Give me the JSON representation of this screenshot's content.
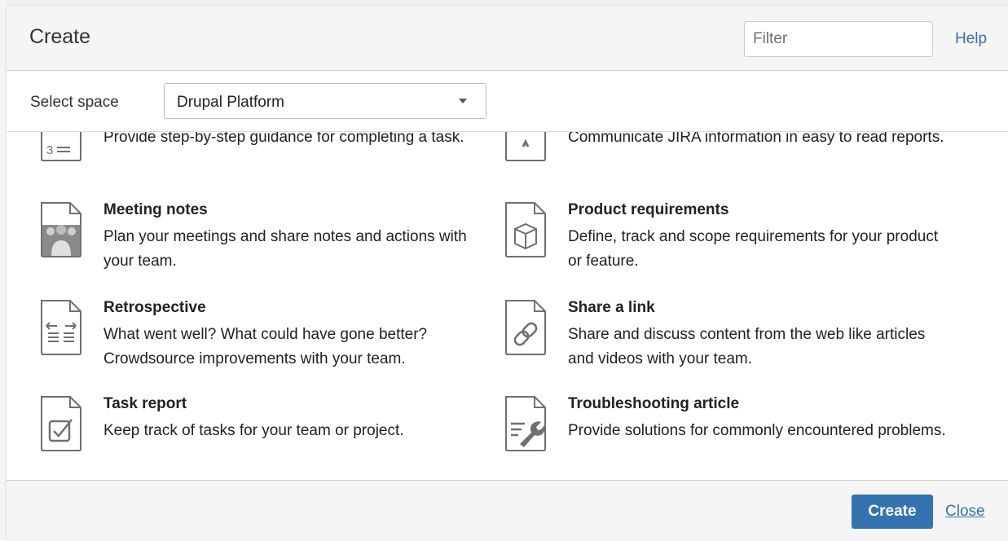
{
  "dialog": {
    "title": "Create",
    "filter_placeholder": "Filter",
    "help_label": "Help"
  },
  "space": {
    "label": "Select space",
    "selected": "Drupal Platform"
  },
  "blueprints": [
    {
      "name": "",
      "description": "Provide step-by-step guidance for completing a task.",
      "icon": "how-to-steps-icon"
    },
    {
      "name": "",
      "description": "Communicate JIRA information in easy to read reports.",
      "icon": "jira-report-icon"
    },
    {
      "name": "Meeting notes",
      "description": "Plan your meetings and share notes and actions with your team.",
      "icon": "meeting-notes-icon"
    },
    {
      "name": "Product requirements",
      "description": "Define, track and scope requirements for your product or feature.",
      "icon": "product-box-icon"
    },
    {
      "name": "Retrospective",
      "description": "What went well? What could have gone better? Crowdsource improvements with your team.",
      "icon": "retrospective-icon"
    },
    {
      "name": "Share a link",
      "description": "Share and discuss content from the web like articles and videos with your team.",
      "icon": "link-icon"
    },
    {
      "name": "Task report",
      "description": "Keep track of tasks for your team or project.",
      "icon": "task-checkbox-icon"
    },
    {
      "name": "Troubleshooting article",
      "description": "Provide solutions for commonly encountered problems.",
      "icon": "wrench-icon"
    }
  ],
  "footer": {
    "create_label": "Create",
    "close_label": "Close"
  },
  "colors": {
    "accent": "#3572b0",
    "header_bg": "#f5f5f5",
    "icon_stroke": "#707070"
  }
}
